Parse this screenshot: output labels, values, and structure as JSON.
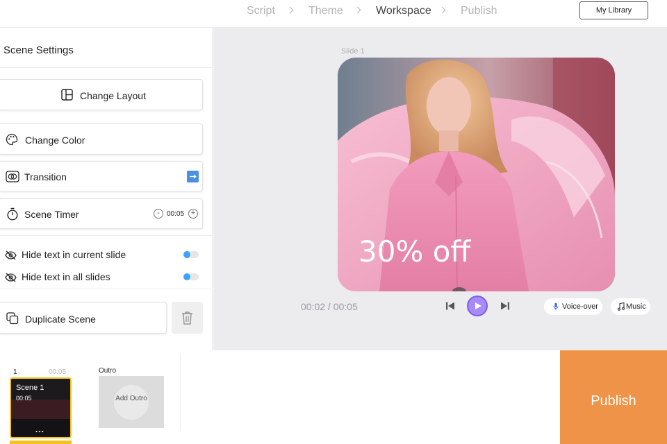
{
  "steps": [
    "Script",
    "Theme",
    "Workspace",
    "Publish"
  ],
  "active_step": "Workspace",
  "header": {
    "library_label": "My Library"
  },
  "sidebar": {
    "title": "Scene Settings",
    "change_layout": "Change Layout",
    "change_color": "Change Color",
    "transition": "Transition",
    "scene_timer": "Scene Timer",
    "timer_value": "00:05",
    "timer_minus": "-",
    "timer_plus": "+",
    "hide_current": "Hide text in current slide",
    "hide_all": "Hide text in all slides",
    "duplicate": "Duplicate Scene"
  },
  "canvas": {
    "slide_label": "Slide 1",
    "overlay_text": "30% off",
    "time_readout": "00:02 / 00:05",
    "voiceover_label": "Voice-over",
    "music_label": "Music"
  },
  "timeline": {
    "scene_number": "1",
    "scene_duration": "00:05",
    "scene_title": "Scene 1",
    "scene_time": "00:05",
    "scene_menu": "...",
    "outro_label": "Outro",
    "add_outro": "Add Outro"
  },
  "publish_label": "Publish",
  "colors": {
    "accent_blue": "#4a90e2",
    "toggle_blue": "#3aa3ff",
    "play_purple": "#a78bfa",
    "publish_orange": "#ee9347",
    "scene_highlight": "#f3c21d",
    "slide_pink": "#f0a5c2"
  },
  "icons": [
    "layout-icon",
    "palette-icon",
    "transition-icon",
    "arrow-right-icon",
    "stopwatch-icon",
    "eye-off-icon",
    "duplicate-icon",
    "trash-icon",
    "skip-back-icon",
    "play-icon",
    "skip-forward-icon",
    "microphone-icon",
    "music-note-icon"
  ]
}
